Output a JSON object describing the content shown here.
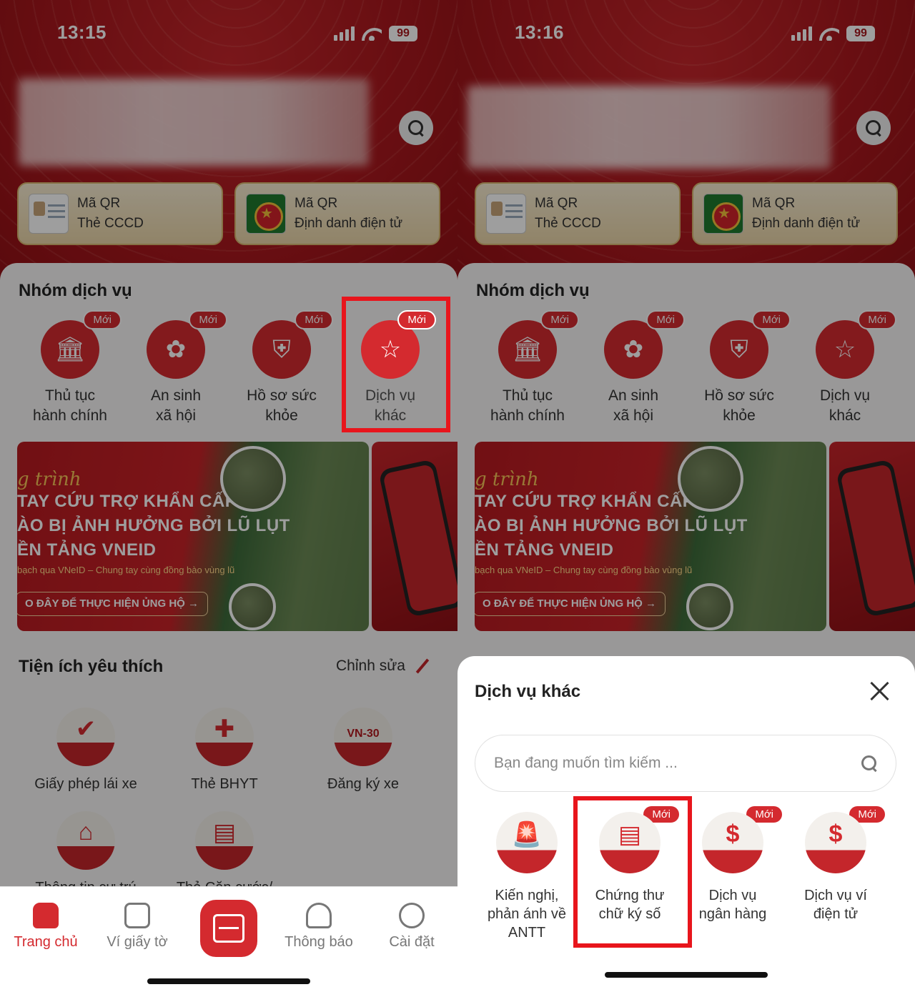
{
  "left": {
    "status": {
      "time": "13:15",
      "battery": "99"
    },
    "qr_cards": [
      {
        "line1": "Mã QR",
        "line2": "Thẻ CCCD"
      },
      {
        "line1": "Mã QR",
        "line2": "Định danh điện tử"
      }
    ],
    "services_title": "Nhóm dịch vụ",
    "services": [
      {
        "line1": "Thủ tục",
        "line2": "hành chính",
        "badge": "Mới",
        "icon": "government-building-icon"
      },
      {
        "line1": "An sinh",
        "line2": "xã hội",
        "badge": "Mới",
        "icon": "social-welfare-icon"
      },
      {
        "line1": "Hồ sơ sức",
        "line2": "khỏe",
        "badge": "Mới",
        "icon": "health-shield-icon"
      },
      {
        "line1": "Dịch vụ",
        "line2": "khác",
        "badge": "Mới",
        "icon": "star-podium-icon"
      }
    ],
    "banner": {
      "script": "g trình",
      "line1": "TAY CỨU TRỢ KHẨN CẤP",
      "line2": "ÀO BỊ ẢNH HƯỞNG BỞI LŨ LỤT",
      "line3": "ỀN TẢNG VNEID",
      "small": "bạch qua VNeID – Chung tay cùng đồng bào vùng lũ",
      "cta": "O ĐÂY ĐỂ THỰC HIỆN ỦNG HỘ →"
    },
    "favorites_title": "Tiện ích yêu thích",
    "favorites_edit": "Chỉnh sửa",
    "favorites": [
      {
        "label": "Giấy phép lái xe",
        "icon": "driver-license-icon"
      },
      {
        "label": "Thẻ BHYT",
        "icon": "health-insurance-icon"
      },
      {
        "label": "Đăng ký xe",
        "icon": "vehicle-plate-icon",
        "plate": "VN-30"
      },
      {
        "label": "Thông tin cư trú",
        "icon": "residence-icon"
      },
      {
        "label": "Thẻ Căn cước/",
        "icon": "id-card-icon"
      }
    ],
    "tabs": [
      {
        "label": "Trang chủ",
        "icon": "home-icon"
      },
      {
        "label": "Ví giấy tờ",
        "icon": "wallet-icon"
      },
      {
        "label": "",
        "icon": "scan-icon"
      },
      {
        "label": "Thông báo",
        "icon": "bell-icon"
      },
      {
        "label": "Cài đặt",
        "icon": "settings-icon"
      }
    ]
  },
  "right": {
    "status": {
      "time": "13:16",
      "battery": "99"
    },
    "sheet": {
      "title": "Dịch vụ khác",
      "search_placeholder": "Bạn đang muốn tìm kiếm ...",
      "items": [
        {
          "line1": "Kiến nghị,",
          "line2": "phản ánh về",
          "line3": "ANTT",
          "badge": "",
          "icon": "siren-icon"
        },
        {
          "line1": "Chứng thư",
          "line2": "chữ ký số",
          "line3": "",
          "badge": "Mới",
          "icon": "digital-certificate-icon"
        },
        {
          "line1": "Dịch vụ",
          "line2": "ngân hàng",
          "line3": "",
          "badge": "Mới",
          "icon": "bank-icon"
        },
        {
          "line1": "Dịch vụ ví",
          "line2": "điện tử",
          "line3": "",
          "badge": "Mới",
          "icon": "e-wallet-icon"
        }
      ]
    }
  },
  "colors": {
    "brand_red": "#d42a2f",
    "highlight_red": "#e8151c",
    "gold": "#f5c457"
  }
}
